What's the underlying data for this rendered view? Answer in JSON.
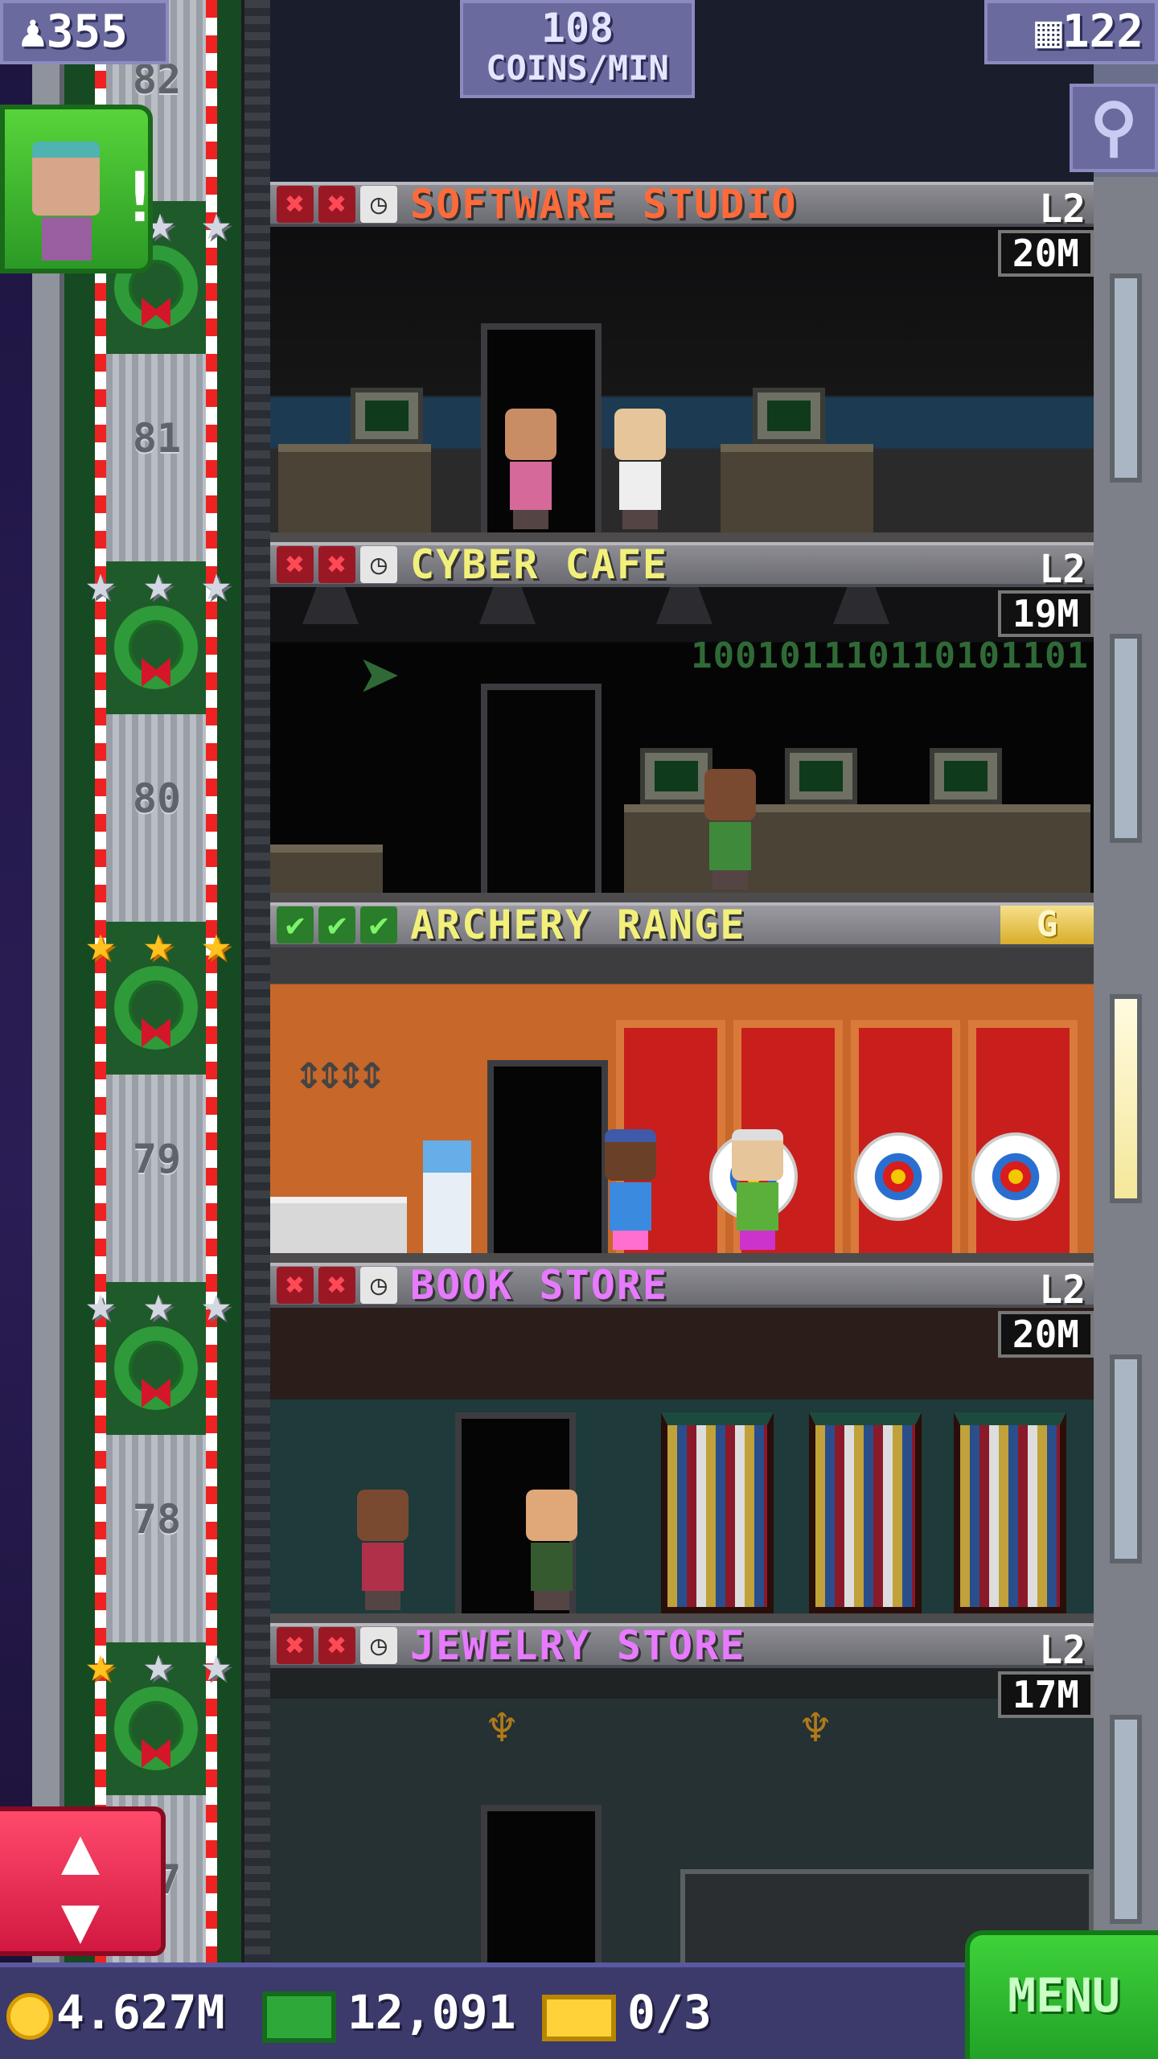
{
  "hud": {
    "population": "355",
    "coins_per_min_value": "108",
    "coins_per_min_label": "COINS/MIN",
    "floor_count": "122"
  },
  "shaft": {
    "labels": [
      "82",
      "81",
      "80",
      "79",
      "78",
      "77"
    ]
  },
  "floors": [
    {
      "name": "SOFTWARE STUDIO",
      "level": "L2",
      "timer": "20M",
      "name_color": "#ff6a3a",
      "status": [
        "x",
        "x",
        "clock"
      ]
    },
    {
      "name": "CYBER CAFE",
      "level": "L2",
      "timer": "19M",
      "name_color": "#f2f07a",
      "status": [
        "x",
        "x",
        "clock"
      ],
      "decor_text": "100101110110101101"
    },
    {
      "name": "ARCHERY RANGE",
      "level": "G",
      "timer": "",
      "name_color": "#f2f07a",
      "status": [
        "check",
        "check",
        "check"
      ]
    },
    {
      "name": "BOOK STORE",
      "level": "L2",
      "timer": "20M",
      "name_color": "#e87aff",
      "status": [
        "x",
        "x",
        "clock"
      ]
    },
    {
      "name": "JEWELRY STORE",
      "level": "L2",
      "timer": "17M",
      "name_color": "#e87aff",
      "status": [
        "x",
        "x",
        "clock"
      ]
    }
  ],
  "star_rows": [
    {
      "stars": [
        "silver",
        "silver"
      ]
    },
    {
      "stars": [
        "silver",
        "silver",
        "silver"
      ]
    },
    {
      "stars": [
        "gold",
        "gold",
        "gold"
      ]
    },
    {
      "stars": [
        "silver",
        "silver",
        "silver"
      ]
    },
    {
      "stars": [
        "gold",
        "silver",
        "silver"
      ]
    }
  ],
  "bottom_bar": {
    "coins": "4.627M",
    "bux": "12,091",
    "tickets": "0/3",
    "menu_label": "MENU"
  },
  "icons": {
    "population": "person-icon",
    "floors": "building-icon",
    "search": "magnifier-icon",
    "elevator": "up-down-arrow-icon",
    "coin": "coin-icon",
    "bux": "bux-icon",
    "ticket": "golden-ticket-icon"
  },
  "colors": {
    "menu_green": "#2fb52f",
    "elevator_red": "#e8264a",
    "hud_purple": "#6a6a9e"
  }
}
